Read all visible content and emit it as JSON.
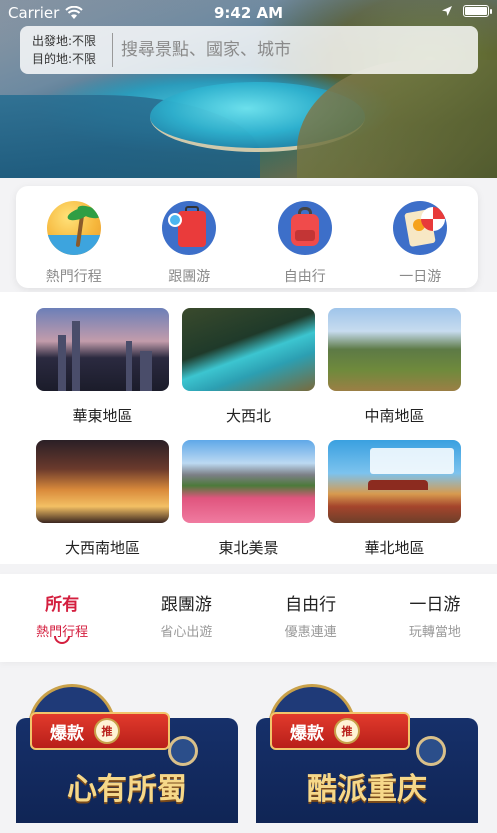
{
  "status_bar": {
    "carrier": "Carrier",
    "time": "9:42 AM"
  },
  "search": {
    "depart_label": "出發地:",
    "depart_value": "不限",
    "dest_label": "目的地:",
    "dest_value": "不限",
    "placeholder": "搜尋景點、國家、城市"
  },
  "categories": [
    {
      "label": "熱門行程",
      "icon": "palm-beach-icon"
    },
    {
      "label": "跟團游",
      "icon": "luggage-icon"
    },
    {
      "label": "自由行",
      "icon": "backpack-icon"
    },
    {
      "label": "一日游",
      "icon": "ticket-umbrella-icon"
    }
  ],
  "regions": [
    {
      "label": "華東地區"
    },
    {
      "label": "大西北"
    },
    {
      "label": "中南地區"
    },
    {
      "label": "大西南地區"
    },
    {
      "label": "東北美景"
    },
    {
      "label": "華北地區"
    }
  ],
  "tabs": [
    {
      "title": "所有",
      "subtitle": "熱門行程",
      "active": true
    },
    {
      "title": "跟團游",
      "subtitle": "省心出遊",
      "active": false
    },
    {
      "title": "自由行",
      "subtitle": "優惠連連",
      "active": false
    },
    {
      "title": "一日游",
      "subtitle": "玩轉當地",
      "active": false
    }
  ],
  "promos": [
    {
      "badge": "爆款",
      "tag": "推",
      "title": "心有所蜀"
    },
    {
      "badge": "爆款",
      "tag": "推",
      "title": "酷派重庆"
    }
  ],
  "colors": {
    "accent": "#d41f3f",
    "muted_text": "#8a8a8a"
  }
}
